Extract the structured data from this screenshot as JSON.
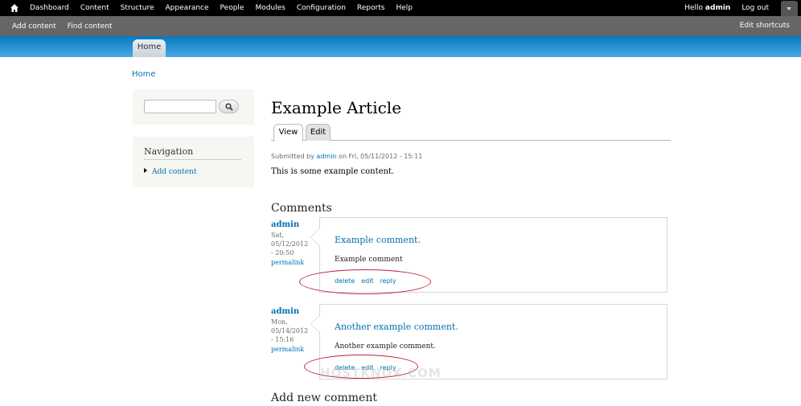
{
  "toolbar": {
    "menu": [
      "Dashboard",
      "Content",
      "Structure",
      "Appearance",
      "People",
      "Modules",
      "Configuration",
      "Reports",
      "Help"
    ],
    "hello": "Hello",
    "username": "admin",
    "logout": "Log out"
  },
  "shortcuts": {
    "items": [
      "Add content",
      "Find content"
    ],
    "edit": "Edit shortcuts"
  },
  "header": {
    "tab": "Home"
  },
  "breadcrumb": "Home",
  "sidebar": {
    "search_button_icon": "search-icon",
    "navigation_title": "Navigation",
    "navigation_items": [
      "Add content"
    ]
  },
  "main": {
    "title": "Example Article",
    "tabs": [
      "View",
      "Edit"
    ],
    "submitted_prefix": "Submitted by",
    "submitted_author": "admin",
    "submitted_suffix": "on Fri, 05/11/2012 - 15:11",
    "body": "This is some example content.",
    "comments_title": "Comments",
    "add_comment_title": "Add new comment"
  },
  "comments": [
    {
      "author": "admin",
      "date_line1": "Sat,",
      "date_line2": "05/12/2012",
      "date_line3": "- 20:50",
      "permalink": "permalink",
      "title": "Example comment.",
      "text": "Example comment",
      "links": [
        "delete",
        "edit",
        "reply"
      ]
    },
    {
      "author": "admin",
      "date_line1": "Mon,",
      "date_line2": "05/14/2012",
      "date_line3": "- 15:16",
      "permalink": "permalink",
      "title": "Another example comment.",
      "text": "Another example comment.",
      "links": [
        "delete",
        "edit",
        "reply"
      ]
    }
  ],
  "watermark": "HOSTKNOX.COM",
  "colors": {
    "link": "#0071b3",
    "toolbar": "#000000",
    "shortcuts": "#666666",
    "header": "#0779bf",
    "highlight": "#c0243b"
  }
}
